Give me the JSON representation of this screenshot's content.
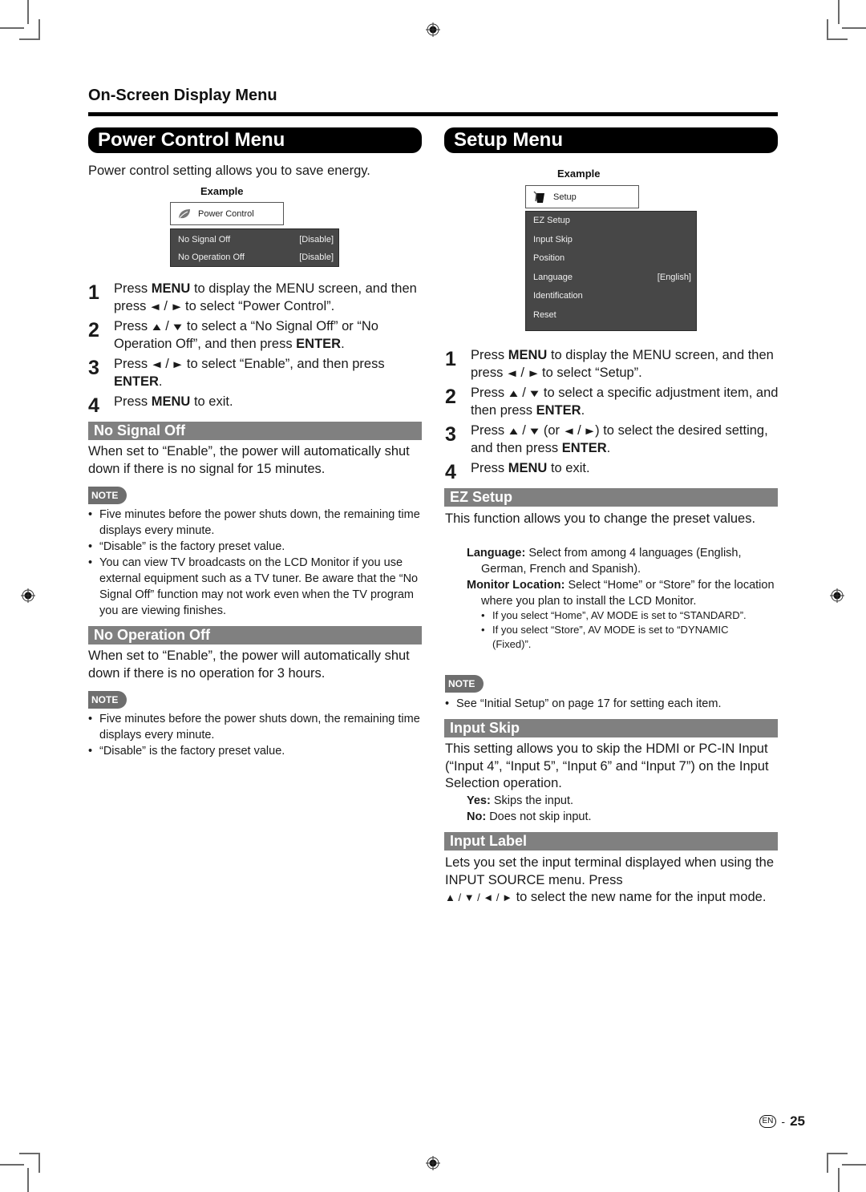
{
  "header": {
    "section_title": "On-Screen Display Menu"
  },
  "power_control": {
    "title": "Power Control Menu",
    "intro": "Power control setting allows you to save energy.",
    "example_label": "Example",
    "menu": {
      "tab_icon": "leaf-icon",
      "tab_label": "Power Control",
      "rows": [
        {
          "label": "No Signal Off",
          "value": "[Disable]"
        },
        {
          "label": "No Operation Off",
          "value": "[Disable]"
        }
      ]
    },
    "steps": [
      {
        "num": "1",
        "parts": [
          "Press ",
          "MENU",
          " to display the MENU screen, and then press ",
          "◄",
          " / ",
          "►",
          " to select “Power Control”."
        ]
      },
      {
        "num": "2",
        "parts": [
          "Press ",
          "▲",
          " / ",
          "▼",
          " to select a “No Signal Off” or “No Operation Off”, and then press ",
          "ENTER",
          "."
        ]
      },
      {
        "num": "3",
        "parts": [
          "Press ",
          "◄",
          " / ",
          "►",
          " to select “Enable”, and then press ",
          "ENTER",
          "."
        ]
      },
      {
        "num": "4",
        "parts": [
          "Press ",
          "MENU",
          " to exit."
        ]
      }
    ],
    "no_signal_off": {
      "title": "No Signal Off",
      "body": "When set to “Enable”, the power will automatically shut down if there is no signal for 15 minutes.",
      "note_label": "NOTE",
      "notes": [
        "Five minutes before the power shuts down, the remaining time displays every minute.",
        "“Disable” is the factory preset value.",
        "You can view TV broadcasts on the LCD Monitor if you use external equipment such as a TV tuner. Be aware that the “No Signal Off” function may not work even when the TV program you are viewing finishes."
      ]
    },
    "no_operation_off": {
      "title": "No Operation Off",
      "body": "When set to “Enable”, the power will automatically shut down if there is no operation for 3 hours.",
      "note_label": "NOTE",
      "notes": [
        "Five minutes before the power shuts down, the remaining time displays every minute.",
        "“Disable” is the factory preset value."
      ]
    }
  },
  "setup": {
    "title": "Setup Menu",
    "example_label": "Example",
    "menu": {
      "tab_icon": "tools-icon",
      "tab_label": "Setup",
      "rows": [
        {
          "label": "EZ Setup",
          "value": ""
        },
        {
          "label": "Input Skip",
          "value": ""
        },
        {
          "label": "Position",
          "value": ""
        },
        {
          "label": "Language",
          "value": "[English]"
        },
        {
          "label": "Identification",
          "value": ""
        },
        {
          "label": "Reset",
          "value": ""
        }
      ]
    },
    "steps": [
      {
        "num": "1",
        "parts": [
          "Press ",
          "MENU",
          " to display the MENU screen, and then press ",
          "◄",
          " / ",
          "►",
          " to select “Setup”."
        ]
      },
      {
        "num": "2",
        "parts": [
          "Press ",
          "▲",
          " / ",
          "▼",
          " to select a specific adjustment item, and then press ",
          "ENTER",
          "."
        ]
      },
      {
        "num": "3",
        "parts": [
          "Press ",
          "▲",
          " / ",
          "▼",
          " (or ",
          "◄",
          " / ",
          "►",
          ") to select the desired setting, and then press ",
          "ENTER",
          "."
        ]
      },
      {
        "num": "4",
        "parts": [
          "Press ",
          "MENU",
          " to exit."
        ]
      }
    ],
    "ez_setup": {
      "title": "EZ Setup",
      "body": "This function allows you to change the preset values.",
      "language_term": "Language:",
      "language_desc": " Select from among 4 languages (English, German, French and Spanish).",
      "location_term": "Monitor Location:",
      "location_desc": " Select “Home” or “Store” for the location where you plan to install the LCD Monitor.",
      "sub_bullets": [
        "If you select “Home”, AV MODE is set to “STANDARD”.",
        "If you select “Store”, AV MODE is set to “DYNAMIC (Fixed)”."
      ],
      "note_label": "NOTE",
      "notes": [
        "See “Initial Setup” on page 17 for setting each item."
      ]
    },
    "input_skip": {
      "title": "Input Skip",
      "body": "This setting allows you to skip the HDMI or PC-IN Input (“Input 4”, “Input 5”, “Input 6” and “Input 7”) on the Input Selection operation.",
      "yes_term": "Yes:",
      "yes_desc": " Skips the input.",
      "no_term": "No:",
      "no_desc": " Does not skip input."
    },
    "input_label": {
      "title": "Input Label",
      "body_line": "Lets you set the input terminal displayed when using the INPUT SOURCE menu. Press",
      "arrows": "▲ / ▼ / ◄ / ►",
      "body_tail": " to select the new name for the input mode."
    }
  },
  "footer": {
    "lang_badge": "EN",
    "separator": "-",
    "page_number": "25"
  }
}
